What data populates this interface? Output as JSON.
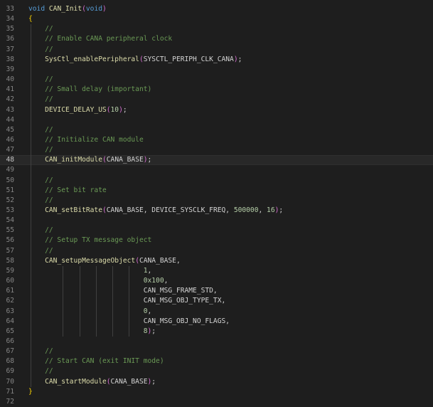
{
  "editor": {
    "theme": {
      "background": "#1e1e1e",
      "keyword": "#569cd6",
      "function": "#dcdcaa",
      "number": "#b5cea8",
      "comment": "#6a9955",
      "bracket_outer": "#ffd700",
      "bracket_inner": "#da70d6",
      "line_number": "#858585"
    },
    "active_line": 48,
    "lines": [
      {
        "n": "33",
        "t": [
          [
            "kw",
            "void"
          ],
          [
            "pn",
            " "
          ],
          [
            "fn",
            "CAN_Init"
          ],
          [
            "br2",
            "("
          ],
          [
            "kw",
            "void"
          ],
          [
            "br2",
            ")"
          ]
        ]
      },
      {
        "n": "34",
        "t": [
          [
            "br1",
            "{"
          ]
        ]
      },
      {
        "n": "35",
        "t": [
          [
            "pn",
            "    "
          ],
          [
            "cm",
            "//"
          ]
        ]
      },
      {
        "n": "36",
        "t": [
          [
            "pn",
            "    "
          ],
          [
            "cm",
            "// Enable CANA peripheral clock"
          ]
        ]
      },
      {
        "n": "37",
        "t": [
          [
            "pn",
            "    "
          ],
          [
            "cm",
            "//"
          ]
        ]
      },
      {
        "n": "38",
        "t": [
          [
            "pn",
            "    "
          ],
          [
            "fn",
            "SysCtl_enablePeripheral"
          ],
          [
            "br2",
            "("
          ],
          [
            "mac",
            "SYSCTL_PERIPH_CLK_CANA"
          ],
          [
            "br2",
            ")"
          ],
          [
            "pn",
            ";"
          ]
        ]
      },
      {
        "n": "39",
        "t": []
      },
      {
        "n": "40",
        "t": [
          [
            "pn",
            "    "
          ],
          [
            "cm",
            "//"
          ]
        ]
      },
      {
        "n": "41",
        "t": [
          [
            "pn",
            "    "
          ],
          [
            "cm",
            "// Small delay (important)"
          ]
        ]
      },
      {
        "n": "42",
        "t": [
          [
            "pn",
            "    "
          ],
          [
            "cm",
            "//"
          ]
        ]
      },
      {
        "n": "43",
        "t": [
          [
            "pn",
            "    "
          ],
          [
            "fn",
            "DEVICE_DELAY_US"
          ],
          [
            "br2",
            "("
          ],
          [
            "num",
            "10"
          ],
          [
            "br2",
            ")"
          ],
          [
            "pn",
            ";"
          ]
        ]
      },
      {
        "n": "44",
        "t": []
      },
      {
        "n": "45",
        "t": [
          [
            "pn",
            "    "
          ],
          [
            "cm",
            "//"
          ]
        ]
      },
      {
        "n": "46",
        "t": [
          [
            "pn",
            "    "
          ],
          [
            "cm",
            "// Initialize CAN module"
          ]
        ]
      },
      {
        "n": "47",
        "t": [
          [
            "pn",
            "    "
          ],
          [
            "cm",
            "//"
          ]
        ]
      },
      {
        "n": "48",
        "t": [
          [
            "pn",
            "    "
          ],
          [
            "fn",
            "CAN_initModule"
          ],
          [
            "br2",
            "("
          ],
          [
            "mac",
            "CANA_BASE"
          ],
          [
            "br2",
            ")"
          ],
          [
            "pn",
            ";"
          ]
        ]
      },
      {
        "n": "49",
        "t": []
      },
      {
        "n": "50",
        "t": [
          [
            "pn",
            "    "
          ],
          [
            "cm",
            "//"
          ]
        ]
      },
      {
        "n": "51",
        "t": [
          [
            "pn",
            "    "
          ],
          [
            "cm",
            "// Set bit rate"
          ]
        ]
      },
      {
        "n": "52",
        "t": [
          [
            "pn",
            "    "
          ],
          [
            "cm",
            "//"
          ]
        ]
      },
      {
        "n": "53",
        "t": [
          [
            "pn",
            "    "
          ],
          [
            "fn",
            "CAN_setBitRate"
          ],
          [
            "br2",
            "("
          ],
          [
            "mac",
            "CANA_BASE, DEVICE_SYSCLK_FREQ, "
          ],
          [
            "num",
            "500000"
          ],
          [
            "pn",
            ", "
          ],
          [
            "num",
            "16"
          ],
          [
            "br2",
            ")"
          ],
          [
            "pn",
            ";"
          ]
        ]
      },
      {
        "n": "54",
        "t": []
      },
      {
        "n": "55",
        "t": [
          [
            "pn",
            "    "
          ],
          [
            "cm",
            "//"
          ]
        ]
      },
      {
        "n": "56",
        "t": [
          [
            "pn",
            "    "
          ],
          [
            "cm",
            "// Setup TX message object"
          ]
        ]
      },
      {
        "n": "57",
        "t": [
          [
            "pn",
            "    "
          ],
          [
            "cm",
            "//"
          ]
        ]
      },
      {
        "n": "58",
        "t": [
          [
            "pn",
            "    "
          ],
          [
            "fn",
            "CAN_setupMessageObject"
          ],
          [
            "br2",
            "("
          ],
          [
            "mac",
            "CANA_BASE,"
          ]
        ]
      },
      {
        "n": "59",
        "t": [
          [
            "pn",
            "                            "
          ],
          [
            "num",
            "1"
          ],
          [
            "pn",
            ","
          ]
        ]
      },
      {
        "n": "60",
        "t": [
          [
            "pn",
            "                            "
          ],
          [
            "num",
            "0x100"
          ],
          [
            "pn",
            ","
          ]
        ]
      },
      {
        "n": "61",
        "t": [
          [
            "pn",
            "                            "
          ],
          [
            "mac",
            "CAN_MSG_FRAME_STD,"
          ]
        ]
      },
      {
        "n": "62",
        "t": [
          [
            "pn",
            "                            "
          ],
          [
            "mac",
            "CAN_MSG_OBJ_TYPE_TX,"
          ]
        ]
      },
      {
        "n": "63",
        "t": [
          [
            "pn",
            "                            "
          ],
          [
            "num",
            "0"
          ],
          [
            "pn",
            ","
          ]
        ]
      },
      {
        "n": "64",
        "t": [
          [
            "pn",
            "                            "
          ],
          [
            "mac",
            "CAN_MSG_OBJ_NO_FLAGS,"
          ]
        ]
      },
      {
        "n": "65",
        "t": [
          [
            "pn",
            "                            "
          ],
          [
            "num",
            "8"
          ],
          [
            "br2",
            ")"
          ],
          [
            "pn",
            ";"
          ]
        ]
      },
      {
        "n": "66",
        "t": []
      },
      {
        "n": "67",
        "t": [
          [
            "pn",
            "    "
          ],
          [
            "cm",
            "//"
          ]
        ]
      },
      {
        "n": "68",
        "t": [
          [
            "pn",
            "    "
          ],
          [
            "cm",
            "// Start CAN (exit INIT mode)"
          ]
        ]
      },
      {
        "n": "69",
        "t": [
          [
            "pn",
            "    "
          ],
          [
            "cm",
            "//"
          ]
        ]
      },
      {
        "n": "70",
        "t": [
          [
            "pn",
            "    "
          ],
          [
            "fn",
            "CAN_startModule"
          ],
          [
            "br2",
            "("
          ],
          [
            "mac",
            "CANA_BASE"
          ],
          [
            "br2",
            ")"
          ],
          [
            "pn",
            ";"
          ]
        ]
      },
      {
        "n": "71",
        "t": [
          [
            "br1",
            "}"
          ]
        ]
      },
      {
        "n": "72",
        "t": []
      }
    ]
  }
}
